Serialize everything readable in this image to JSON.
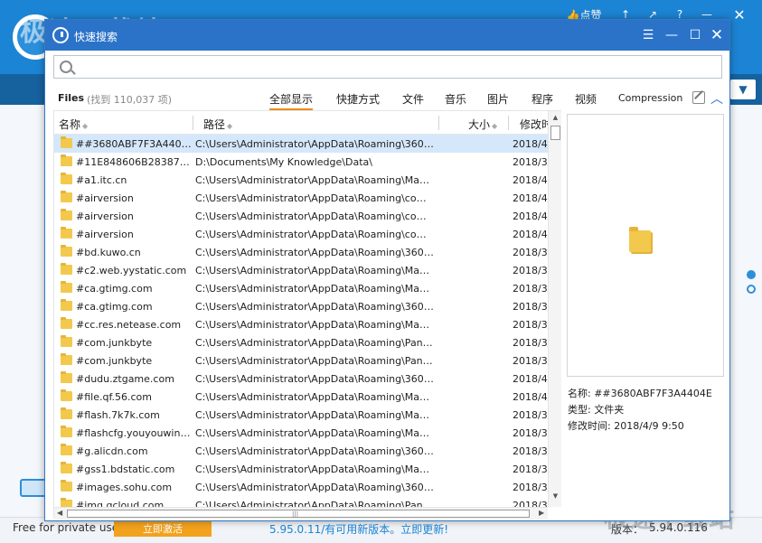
{
  "background_app": {
    "logo_text": "极速下载站",
    "top_buttons": {
      "like": "👍点赞",
      "up": "↑",
      "share": "↗",
      "help": "?",
      "min": "—",
      "close": "✕"
    },
    "dropdown": "▼",
    "footer_left": "Free for private use",
    "activate_button": "立即激活",
    "update_notice": "5.95.0.11/有可用新版本。立即更新!",
    "version_label": "版本：",
    "version_value": "5.94.0.116 ",
    "watermark": "极速下载站"
  },
  "window": {
    "title": "快速搜索",
    "buttons": {
      "menu": "☰",
      "min": "—",
      "max": "☐",
      "close": "✕"
    }
  },
  "search": {
    "value": "",
    "placeholder": ""
  },
  "filter": {
    "files_label": "Files",
    "files_count": "(找到 110,037 项)",
    "tabs": [
      "全部显示",
      "快捷方式",
      "文件",
      "音乐",
      "图片",
      "程序",
      "视频",
      "Compression"
    ],
    "collapse": "︿"
  },
  "columns": {
    "name": "名称",
    "path": "路径",
    "size": "大小",
    "modified": "修改时"
  },
  "rows": [
    {
      "name": "##3680ABF7F3A4404E",
      "path": "C:\\Users\\Administrator\\AppData\\Roaming\\360se6\\...",
      "date": "2018/4/"
    },
    {
      "name": "#11E848606B2838733...",
      "path": "D:\\Documents\\My Knowledge\\Data\\",
      "date": "2018/3/"
    },
    {
      "name": "#a1.itc.cn",
      "path": "C:\\Users\\Administrator\\AppData\\Roaming\\Macrome...",
      "date": "2018/4/"
    },
    {
      "name": "#airversion",
      "path": "C:\\Users\\Administrator\\AppData\\Roaming\\com.won...",
      "date": "2018/4/"
    },
    {
      "name": "#airversion",
      "path": "C:\\Users\\Administrator\\AppData\\Roaming\\com.won...",
      "date": "2018/4/"
    },
    {
      "name": "#airversion",
      "path": "C:\\Users\\Administrator\\AppData\\Roaming\\com.won...",
      "date": "2018/4/"
    },
    {
      "name": "#bd.kuwo.cn",
      "path": "C:\\Users\\Administrator\\AppData\\Roaming\\360se6\\...",
      "date": "2018/3/"
    },
    {
      "name": "#c2.web.yystatic.com",
      "path": "C:\\Users\\Administrator\\AppData\\Roaming\\Macrome...",
      "date": "2018/3/"
    },
    {
      "name": "#ca.gtimg.com",
      "path": "C:\\Users\\Administrator\\AppData\\Roaming\\Macrome...",
      "date": "2018/3/"
    },
    {
      "name": "#ca.gtimg.com",
      "path": "C:\\Users\\Administrator\\AppData\\Roaming\\360se6\\...",
      "date": "2018/3/"
    },
    {
      "name": "#cc.res.netease.com",
      "path": "C:\\Users\\Administrator\\AppData\\Roaming\\Macrome...",
      "date": "2018/3/"
    },
    {
      "name": "#com.junkbyte",
      "path": "C:\\Users\\Administrator\\AppData\\Roaming\\PandaTV...",
      "date": "2018/3/"
    },
    {
      "name": "#com.junkbyte",
      "path": "C:\\Users\\Administrator\\AppData\\Roaming\\PandaTV...",
      "date": "2018/3/"
    },
    {
      "name": "#dudu.ztgame.com",
      "path": "C:\\Users\\Administrator\\AppData\\Roaming\\360se6\\...",
      "date": "2018/4/"
    },
    {
      "name": "#file.qf.56.com",
      "path": "C:\\Users\\Administrator\\AppData\\Roaming\\Macrome...",
      "date": "2018/4/"
    },
    {
      "name": "#flash.7k7k.com",
      "path": "C:\\Users\\Administrator\\AppData\\Roaming\\Macrome...",
      "date": "2018/3/"
    },
    {
      "name": "#flashcfg.youyouwin.c...",
      "path": "C:\\Users\\Administrator\\AppData\\Roaming\\Macrome...",
      "date": "2018/3/"
    },
    {
      "name": "#g.alicdn.com",
      "path": "C:\\Users\\Administrator\\AppData\\Roaming\\360se6\\...",
      "date": "2018/3/"
    },
    {
      "name": "#gss1.bdstatic.com",
      "path": "C:\\Users\\Administrator\\AppData\\Roaming\\Macrome...",
      "date": "2018/3/"
    },
    {
      "name": "#images.sohu.com",
      "path": "C:\\Users\\Administrator\\AppData\\Roaming\\360se6\\...",
      "date": "2018/3/"
    },
    {
      "name": "#img.qcloud.com",
      "path": "C:\\Users\\Administrator\\AppData\\Roaming\\PandaTV...",
      "date": "2018/3/"
    }
  ],
  "selected_row_index": 0,
  "scroll": {
    "up": "▲",
    "down": "▼",
    "left": "◀",
    "right": "▶",
    "grip": "|||"
  },
  "preview": {
    "name_label": "名称: ##3680ABF7F3A4404E",
    "type_label": "类型: 文件夹",
    "modified_label": "修改时间: 2018/4/9 9:50"
  },
  "colors": {
    "titlebar": "#2a73c9",
    "accent_tab": "#f08a18",
    "selected_row": "#d5e7fa",
    "folder": "#f2c94c"
  }
}
